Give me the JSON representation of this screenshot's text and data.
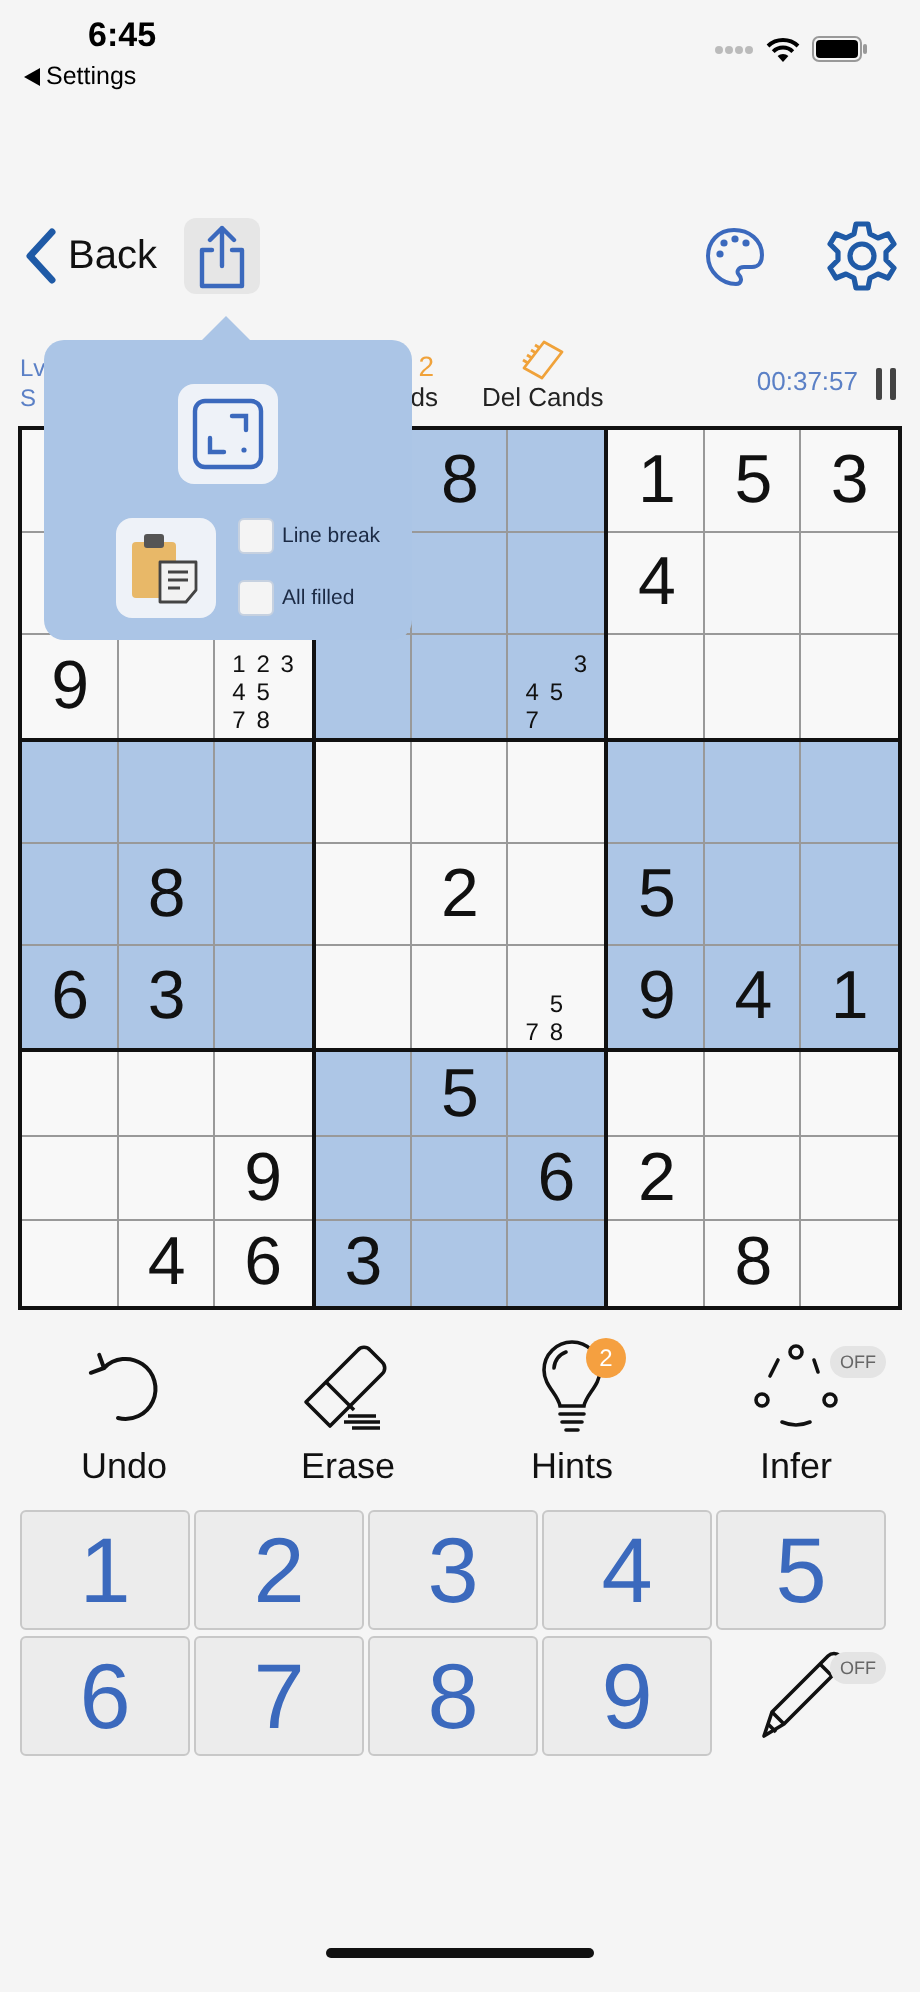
{
  "status_bar": {
    "time": "6:45",
    "back_app": "Settings"
  },
  "nav": {
    "back": "Back",
    "share": {
      "selected": true
    }
  },
  "info": {
    "level_label": "Lv",
    "sub_label": "S",
    "hint_count": "2",
    "cands_label": "ds",
    "del_cands": "Del Cands",
    "timer": "00:37:57"
  },
  "popup": {
    "checkboxes": [
      {
        "label": "Line break",
        "checked": false
      },
      {
        "label": "All filled",
        "checked": false
      }
    ]
  },
  "grid": {
    "boxes": [
      {
        "shaded": false,
        "cells": [
          {},
          {},
          {},
          {},
          {},
          {},
          {
            "digit": "9"
          },
          {},
          {
            "candidates": [
              "1",
              "2",
              "3",
              "4",
              "5",
              "7",
              "8"
            ]
          }
        ]
      },
      {
        "shaded": true,
        "cells": [
          {},
          {
            "digit": "8"
          },
          {},
          {},
          {},
          {},
          {},
          {},
          {
            "candidates": [
              "3",
              "4",
              "5",
              "7"
            ]
          }
        ]
      },
      {
        "shaded": false,
        "cells": [
          {
            "digit": "1"
          },
          {
            "digit": "5"
          },
          {
            "digit": "3"
          },
          {
            "digit": "4"
          },
          {},
          {},
          {},
          {},
          {}
        ]
      },
      {
        "shaded": true,
        "cells": [
          {},
          {},
          {},
          {},
          {
            "digit": "8"
          },
          {},
          {
            "digit": "6"
          },
          {
            "digit": "3"
          },
          {}
        ]
      },
      {
        "shaded": false,
        "cells": [
          {},
          {},
          {},
          {},
          {
            "digit": "2"
          },
          {},
          {},
          {},
          {
            "candidates": [
              "5",
              "7",
              "8"
            ]
          }
        ]
      },
      {
        "shaded": true,
        "cells": [
          {},
          {},
          {},
          {
            "digit": "5"
          },
          {},
          {},
          {
            "digit": "9"
          },
          {
            "digit": "4"
          },
          {
            "digit": "1"
          }
        ]
      },
      {
        "shaded": false,
        "cells": [
          {},
          {},
          {},
          {},
          {},
          {
            "digit": "9"
          },
          {},
          {
            "digit": "4"
          },
          {
            "digit": "6"
          }
        ]
      },
      {
        "shaded": true,
        "cells": [
          {},
          {
            "digit": "5"
          },
          {},
          {},
          {},
          {
            "digit": "6"
          },
          {
            "digit": "3"
          },
          {},
          {}
        ]
      },
      {
        "shaded": false,
        "cells": [
          {},
          {},
          {},
          {
            "digit": "2"
          },
          {},
          {},
          {},
          {
            "digit": "8"
          },
          {}
        ]
      }
    ]
  },
  "tools": [
    {
      "kind": "undo",
      "label": "Undo"
    },
    {
      "kind": "erase",
      "label": "Erase"
    },
    {
      "kind": "hints",
      "label": "Hints",
      "badge": "2"
    },
    {
      "kind": "infer",
      "label": "Infer",
      "toggle": "OFF"
    }
  ],
  "keypad": {
    "keys": [
      "1",
      "2",
      "3",
      "4",
      "5",
      "6",
      "7",
      "8",
      "9"
    ],
    "pencil": {
      "toggle": "OFF"
    }
  }
}
